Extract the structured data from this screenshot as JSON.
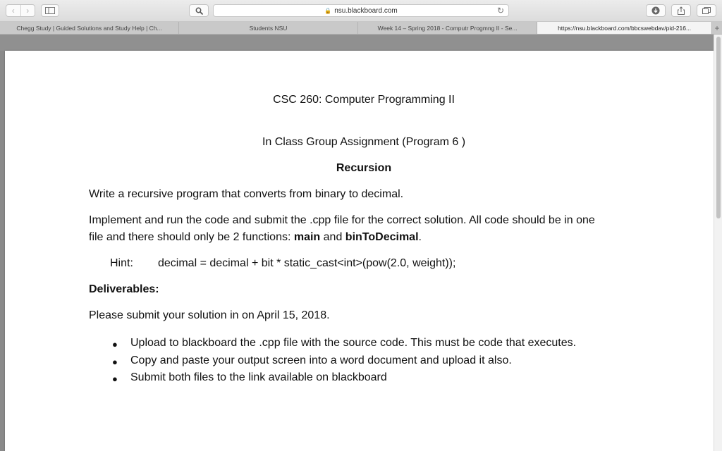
{
  "browser": {
    "address": "nsu.blackboard.com",
    "tabs": [
      "Chegg Study | Guided Solutions and Study Help | Ch...",
      "Students NSU",
      "Week 14 – Spring 2018 - Computr Progmng II - Se...",
      "https://nsu.blackboard.com/bbcswebdav/pid-216..."
    ],
    "active_tab": 3
  },
  "document": {
    "course_title": "CSC 260: Computer Programming II",
    "assignment": "In Class Group Assignment (Program 6 )",
    "topic": "Recursion",
    "intro": "Write a recursive program that converts from binary to decimal.",
    "para_line1": "Implement and run the code and submit the .cpp file for the correct solution. All code should be in one",
    "para_line2_a": "file and there should only be 2 functions: ",
    "fn_main": "main",
    "para_and": " and ",
    "fn_bin": "binToDecimal",
    "para_end": ".",
    "hint_label": "Hint:",
    "hint_code": "decimal = decimal + bit * static_cast<int>(pow(2.0, weight));",
    "deliverables_heading": "Deliverables:",
    "due_text": "Please submit your solution in on April 15, 2018.",
    "bullets": [
      "Upload to blackboard the .cpp file with the source code. This must be code that executes.",
      "Copy and paste your output screen into a word document and upload it also.",
      "Submit both files to the link available on blackboard"
    ]
  }
}
